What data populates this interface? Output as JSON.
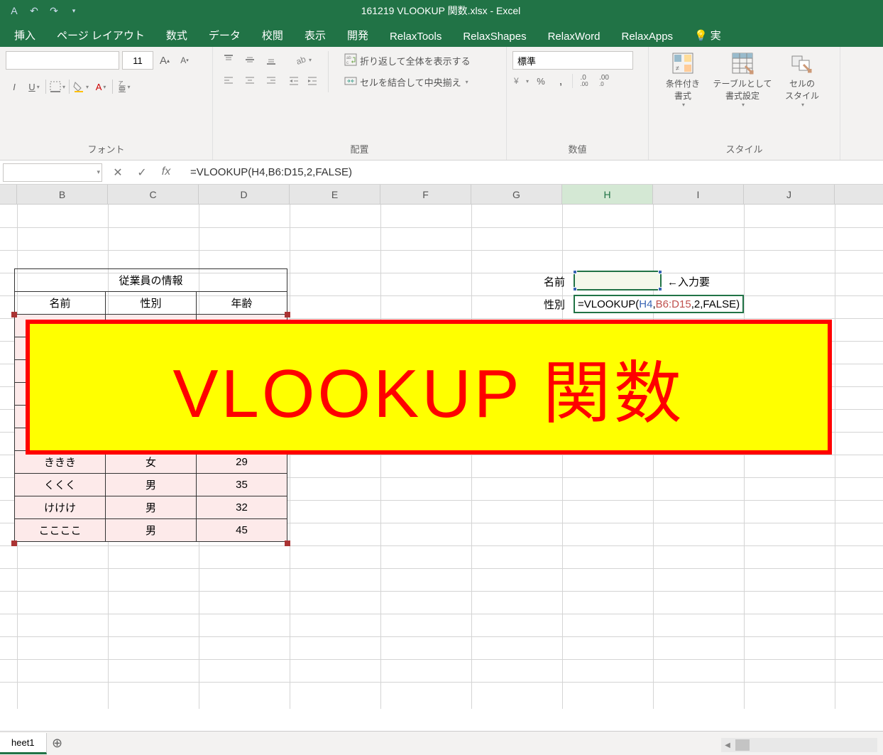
{
  "titlebar": {
    "title": "161219 VLOOKUP 関数.xlsx  -  Excel"
  },
  "tabs": [
    "挿入",
    "ページ レイアウト",
    "数式",
    "データ",
    "校閲",
    "表示",
    "開発",
    "RelaxTools",
    "RelaxShapes",
    "RelaxWord",
    "RelaxApps"
  ],
  "tell_me_prefix": "実",
  "ribbon": {
    "font": {
      "size": "11",
      "group_label": "フォント"
    },
    "align": {
      "wrap": "折り返して全体を表示する",
      "merge": "セルを結合して中央揃え",
      "group_label": "配置"
    },
    "number": {
      "format": "標準",
      "group_label": "数値"
    },
    "styles": {
      "cond": "条件付き\n書式",
      "table": "テーブルとして\n書式設定",
      "cell": "セルの\nスタイル",
      "group_label": "スタイル"
    }
  },
  "formula_bar": {
    "value": "=VLOOKUP(H4,B6:D15,2,FALSE)"
  },
  "columns": [
    "B",
    "C",
    "D",
    "E",
    "F",
    "G",
    "H",
    "I",
    "J"
  ],
  "employee": {
    "title": "従業員の情報",
    "headers": [
      "名前",
      "性別",
      "年齢"
    ],
    "rows": [
      [
        "ききき",
        "女",
        "29"
      ],
      [
        "くくく",
        "男",
        "35"
      ],
      [
        "けけけ",
        "男",
        "32"
      ],
      [
        "ここここ",
        "男",
        "45"
      ]
    ]
  },
  "lookup": {
    "name_label": "名前",
    "gender_label": "性別",
    "input_hint": "←入力要",
    "formula_display": {
      "eq": "=",
      "fn": "VLOOKUP",
      "open": "(",
      "a1": "H4",
      "c1": ",",
      "a2": "B6:D15",
      "c2": ",",
      "a3": "2",
      "c3": ",",
      "a4": "FALSE",
      "close": ")"
    }
  },
  "overlay": {
    "text": "VLOOKUP 関数"
  },
  "sheet": {
    "name": "heet1"
  }
}
